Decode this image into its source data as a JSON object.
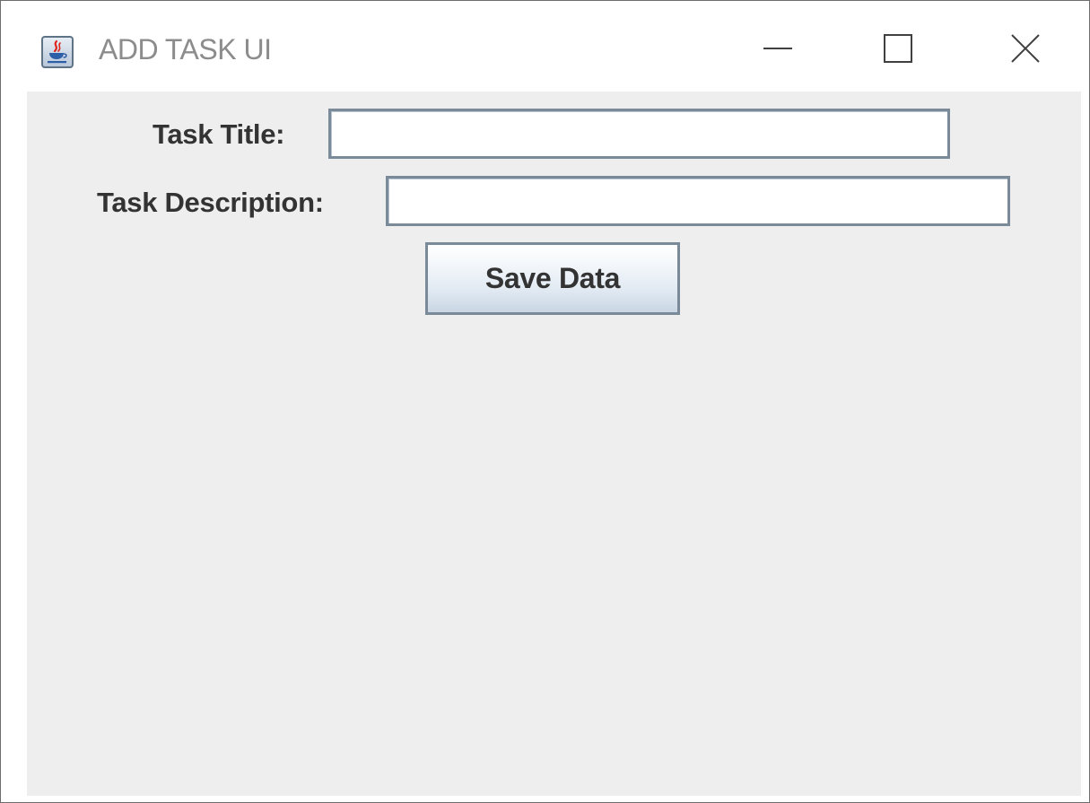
{
  "window": {
    "title": "ADD TASK UI",
    "icon": "java-coffee-cup-icon",
    "controls": {
      "minimize_icon": "minimize-icon",
      "maximize_icon": "maximize-icon",
      "close_icon": "close-icon"
    }
  },
  "form": {
    "title_label": "Task Title:",
    "title_value": "",
    "description_label": "Task Description:",
    "description_value": "",
    "save_label": "Save Data"
  },
  "colors": {
    "content_background": "#eeeeee",
    "field_border": "#7a8a99",
    "title_text": "#8c8c8c",
    "label_text": "#333333"
  }
}
